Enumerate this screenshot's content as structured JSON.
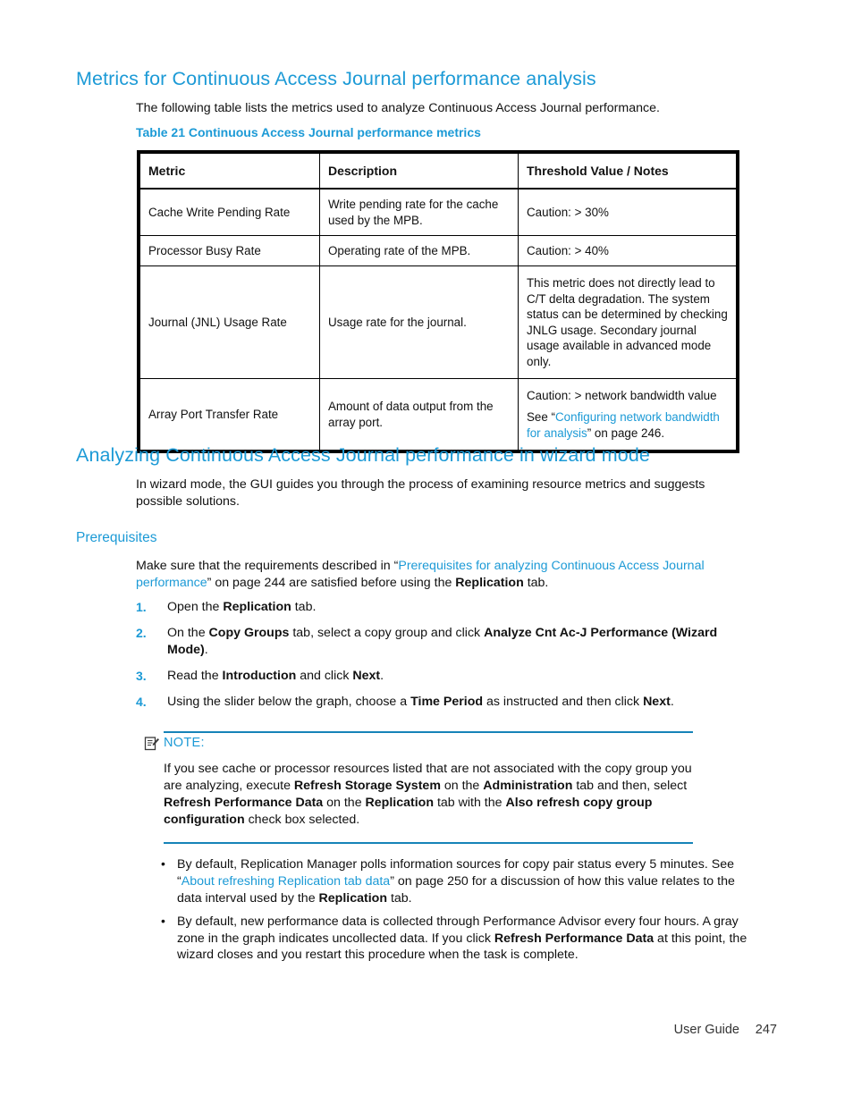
{
  "document": {
    "section1": {
      "heading": "Metrics for Continuous Access Journal performance analysis",
      "intro": "The following table lists the metrics used to analyze Continuous Access Journal performance.",
      "table_caption": "Table 21 Continuous Access Journal performance metrics",
      "table": {
        "headers": [
          "Metric",
          "Description",
          "Threshold Value / Notes"
        ],
        "rows": [
          {
            "metric": "Cache Write Pending Rate",
            "description": "Write pending rate for the cache used by the MPB.",
            "threshold": "Caution: > 30%"
          },
          {
            "metric": "Processor Busy Rate",
            "description": "Operating rate of the MPB.",
            "threshold": "Caution: > 40%"
          },
          {
            "metric": "Journal (JNL) Usage Rate",
            "description": "Usage rate for the journal.",
            "threshold": "This metric does not directly lead to C/T delta degradation. The system status can be determined by checking JNLG usage. Secondary journal usage available in advanced mode only."
          },
          {
            "metric": "Array Port Transfer Rate",
            "description": "Amount of data output from the array port.",
            "threshold_line1": "Caution: > network bandwidth value",
            "threshold_line2_pre": "See “",
            "threshold_line2_link": "Configuring network bandwidth for analysis",
            "threshold_line2_post": "” on page 246."
          }
        ]
      }
    },
    "section2": {
      "heading": "Analyzing Continuous Access Journal performance in wizard mode",
      "intro": "In wizard mode, the GUI guides you through the process of examining resource metrics and suggests possible solutions.",
      "prerequisites_heading": "Prerequisites",
      "prereq_para": {
        "pre": "Make sure that the requirements described in “",
        "link": "Prerequisites for analyzing Continuous Access Journal performance",
        "mid": "” on page 244 are satisfied before using the ",
        "bold": "Replication",
        "post": " tab."
      },
      "steps": [
        {
          "num": "1.",
          "parts": [
            {
              "t": "Open the ",
              "s": "normal"
            },
            {
              "t": "Replication",
              "s": "bold"
            },
            {
              "t": " tab.",
              "s": "normal"
            }
          ]
        },
        {
          "num": "2.",
          "parts": [
            {
              "t": "On the ",
              "s": "normal"
            },
            {
              "t": "Copy Groups",
              "s": "bold"
            },
            {
              "t": " tab, select a copy group and click ",
              "s": "normal"
            },
            {
              "t": "Analyze Cnt Ac-J Performance (Wizard Mode)",
              "s": "bold"
            },
            {
              "t": ".",
              "s": "normal"
            }
          ]
        },
        {
          "num": "3.",
          "parts": [
            {
              "t": "Read the ",
              "s": "normal"
            },
            {
              "t": "Introduction",
              "s": "bold"
            },
            {
              "t": " and click ",
              "s": "normal"
            },
            {
              "t": "Next",
              "s": "bold"
            },
            {
              "t": ".",
              "s": "normal"
            }
          ]
        },
        {
          "num": "4.",
          "parts": [
            {
              "t": "Using the slider below the graph, choose a ",
              "s": "normal"
            },
            {
              "t": "Time Period",
              "s": "bold"
            },
            {
              "t": " as instructed and then click ",
              "s": "normal"
            },
            {
              "t": "Next",
              "s": "bold"
            },
            {
              "t": ".",
              "s": "normal"
            }
          ]
        }
      ],
      "note": {
        "label": "NOTE:",
        "icon": "note-pencil-icon",
        "parts": [
          {
            "t": "If you see cache or processor resources listed that are not associated with the copy group you are analyzing, execute ",
            "s": "normal"
          },
          {
            "t": "Refresh Storage System",
            "s": "bold"
          },
          {
            "t": " on the ",
            "s": "normal"
          },
          {
            "t": "Administration",
            "s": "bold"
          },
          {
            "t": " tab and then, select ",
            "s": "normal"
          },
          {
            "t": "Refresh Performance Data",
            "s": "bold"
          },
          {
            "t": " on the ",
            "s": "normal"
          },
          {
            "t": "Replication",
            "s": "bold"
          },
          {
            "t": " tab with the ",
            "s": "normal"
          },
          {
            "t": "Also refresh copy group configuration",
            "s": "bold"
          },
          {
            "t": " check box selected.",
            "s": "normal"
          }
        ]
      },
      "bullets": [
        {
          "marker": "•",
          "parts": [
            {
              "t": "By default, Replication Manager polls information sources for copy pair status every 5 minutes. See “",
              "s": "normal"
            },
            {
              "t": "About refreshing Replication tab data",
              "s": "link"
            },
            {
              "t": "” on page 250 for a discussion of how this value relates to the data interval used by the ",
              "s": "normal"
            },
            {
              "t": "Replication",
              "s": "bold"
            },
            {
              "t": " tab.",
              "s": "normal"
            }
          ]
        },
        {
          "marker": "•",
          "parts": [
            {
              "t": "By default, new performance data is collected through Performance Advisor every four hours. A gray zone in the graph indicates uncollected data. If you click ",
              "s": "normal"
            },
            {
              "t": "Refresh Performance Data",
              "s": "bold"
            },
            {
              "t": " at this point, the wizard closes and you restart this procedure when the task is complete.",
              "s": "normal"
            }
          ]
        }
      ]
    },
    "footer": {
      "label": "User Guide",
      "page_number": "247"
    },
    "colors": {
      "heading_blue": "#1C9AD6",
      "link_blue": "#1C9AD6",
      "rule_blue": "#1683B8",
      "text_black": "#111111",
      "table_border": "#000000"
    }
  }
}
